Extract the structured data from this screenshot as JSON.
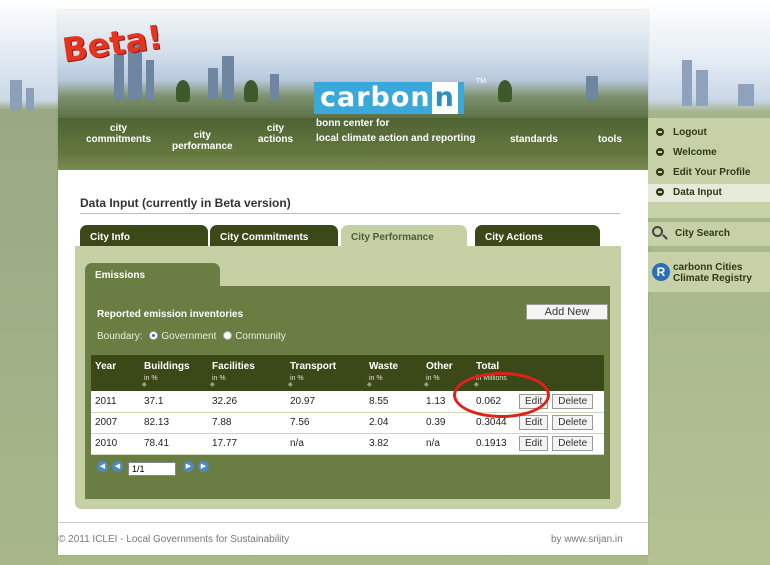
{
  "banner": {
    "beta_label": "Beta!",
    "logo_text": "carbon",
    "logo_n": "n",
    "tm": "TM"
  },
  "nav": {
    "city_commitments": [
      "city",
      "commitments"
    ],
    "city_performance": [
      "city",
      "performance"
    ],
    "city_actions": [
      "city",
      "actions"
    ],
    "tagline": [
      "bonn center for",
      "local climate action and reporting"
    ],
    "standards": "standards",
    "tools": "tools"
  },
  "sidebar": {
    "items": [
      "Logout",
      "Welcome",
      "Edit Your Profile",
      "Data Input"
    ],
    "active": "Data Input",
    "search": "City Search",
    "registry": [
      "carbonn Cities",
      "Climate Registry"
    ],
    "registry_badge": "R"
  },
  "page": {
    "title": "Data Input (currently in Beta version)"
  },
  "tabs": [
    "City Info",
    "City Commitments",
    "City Performance",
    "City Actions"
  ],
  "active_tab": "City Performance",
  "subtab": "Emissions",
  "panel": {
    "reported": "Reported emission inventories",
    "add_new": "Add New",
    "boundary_label": "Boundary:",
    "boundary_options": [
      "Government",
      "Community"
    ],
    "boundary_selected": "Government"
  },
  "table": {
    "columns": [
      {
        "label": "Year",
        "unit": ""
      },
      {
        "label": "Buildings",
        "unit": "in %"
      },
      {
        "label": "Facilities",
        "unit": "in %"
      },
      {
        "label": "Transport",
        "unit": "in %"
      },
      {
        "label": "Waste",
        "unit": "in %"
      },
      {
        "label": "Other",
        "unit": "in %"
      },
      {
        "label": "Total",
        "unit": "in Millions"
      }
    ],
    "rows": [
      [
        "2011",
        "37.1",
        "32.26",
        "20.97",
        "8.55",
        "1.13",
        "0.062"
      ],
      [
        "2007",
        "82.13",
        "7.88",
        "7.56",
        "2.04",
        "0.39",
        "0.3044"
      ],
      [
        "2010",
        "78.41",
        "17.77",
        "n/a",
        "3.82",
        "n/a",
        "0.1913"
      ]
    ],
    "edit_label": "Edit",
    "delete_label": "Delete"
  },
  "pager": {
    "value": "1/1"
  },
  "footer": {
    "left": "© 2011 ICLEI - Local Governments for Sustainability",
    "right": "by www.srijan.in"
  },
  "colors": {
    "highlight_circle": "#e2201a",
    "dark_olive": "#3b4919",
    "panel_green": "#c5d0a5"
  }
}
